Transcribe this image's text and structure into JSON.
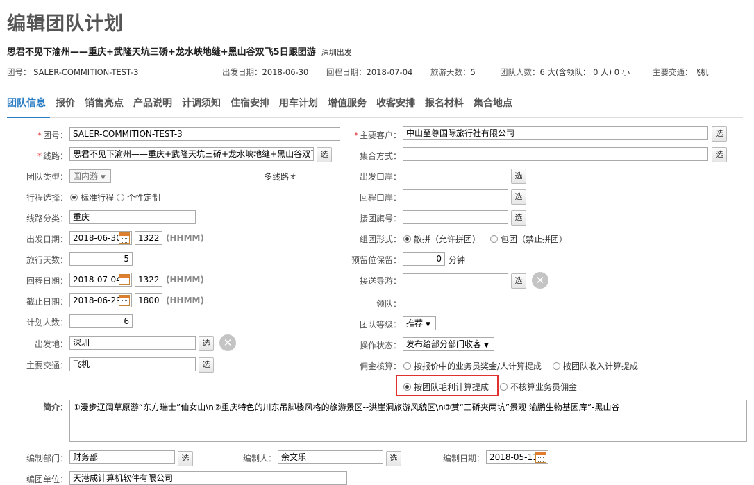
{
  "page": {
    "title": "编辑团队计划"
  },
  "route": {
    "title": "思君不见下渝州——重庆+武隆天坑三硚+龙水峡地缝+黑山谷双飞5日跟团游",
    "depart_city": "深圳出发"
  },
  "meta": {
    "team_no_label": "团号：",
    "team_no": "SALER-COMMITION-TEST-3",
    "depart_label": "出发日期：",
    "depart": "2018-06-30",
    "return_label": "回程日期：",
    "return": "2018-07-04",
    "days_label": "旅游天数：",
    "days": "5",
    "people_label": "团队人数：",
    "people": "6 大(含领队： 0 人) 0 小",
    "transport_label": "主要交通：",
    "transport": "飞机"
  },
  "tabs": [
    {
      "label": "团队信息",
      "active": true
    },
    {
      "label": "报价"
    },
    {
      "label": "销售亮点"
    },
    {
      "label": "产品说明"
    },
    {
      "label": "计调须知"
    },
    {
      "label": "住宿安排"
    },
    {
      "label": "用车计划"
    },
    {
      "label": "增值服务"
    },
    {
      "label": "收客安排"
    },
    {
      "label": "报名材料"
    },
    {
      "label": "集合地点"
    }
  ],
  "form": {
    "select_btn": "选",
    "hhmm": "(HHMM)",
    "team_no": {
      "label": "团号：",
      "value": "SALER-COMMITION-TEST-3"
    },
    "route": {
      "label": "线路：",
      "value": "思君不见下渝州——重庆+武隆天坑三硚+龙水峡地缝+黑山谷双飞"
    },
    "team_type": {
      "label": "团队类型：",
      "value": "国内游"
    },
    "multi_route": {
      "label": "多线路团"
    },
    "itinerary": {
      "label": "行程选择：",
      "opt1": "标准行程",
      "opt2": "个性定制"
    },
    "route_cat": {
      "label": "线路分类：",
      "value": "重庆"
    },
    "depart_date": {
      "label": "出发日期：",
      "date": "2018-06-30",
      "time": "1322"
    },
    "travel_days": {
      "label": "旅行天数：",
      "value": "5"
    },
    "return_date": {
      "label": "回程日期：",
      "date": "2018-07-04",
      "time": "1322"
    },
    "deadline": {
      "label": "截止日期：",
      "date": "2018-06-29",
      "time": "1800"
    },
    "planned_people": {
      "label": "计划人数：",
      "value": "6"
    },
    "depart_place": {
      "label": "出发地：",
      "value": "深圳"
    },
    "main_transport": {
      "label": "主要交通：",
      "value": "飞机"
    },
    "main_client": {
      "label": "主要客户：",
      "value": "中山至尊国际旅行社有限公司"
    },
    "assembly": {
      "label": "集合方式：",
      "value": ""
    },
    "depart_port": {
      "label": "出发口岸：",
      "value": ""
    },
    "return_port": {
      "label": "回程口岸：",
      "value": ""
    },
    "flag_no": {
      "label": "接团旗号：",
      "value": ""
    },
    "group_form": {
      "label": "组团形式：",
      "opt1": "散拼（允许拼团）",
      "opt2": "包团（禁止拼团）"
    },
    "reserve": {
      "label": "预留位保留：",
      "value": "0",
      "unit": "分钟"
    },
    "guide": {
      "label": "接送导游：",
      "value": ""
    },
    "leader": {
      "label": "领队：",
      "value": ""
    },
    "grade": {
      "label": "团队等级：",
      "value": "推荐"
    },
    "op_status": {
      "label": "操作状态：",
      "value": "发布给部分部门收客"
    },
    "commission": {
      "label": "佣金核算：",
      "opt1": "按报价中的业务员奖金/人计算提成",
      "opt2": "按团队收入计算提成",
      "opt3": "按团队毛利计算提成",
      "opt4": "不核算业务员佣金"
    },
    "summary": {
      "label": "简介：",
      "value": "①漫步辽阔草原游“东方瑞士”仙女山\\n②重庆特色的川东吊脚楼风格的旅游景区--洪崖洞旅游风貌区\\n③赏“三硚夹两坑”景观 渝鹏生物基因库”-黑山谷"
    },
    "dept": {
      "label": "编制部门：",
      "value": "财务部"
    },
    "editor": {
      "label": "编制人：",
      "value": "余文乐"
    },
    "edit_date": {
      "label": "编制日期：",
      "value": "2018-05-11"
    },
    "unit": {
      "label": "编团单位：",
      "value": "天港成计算机软件有限公司"
    }
  }
}
